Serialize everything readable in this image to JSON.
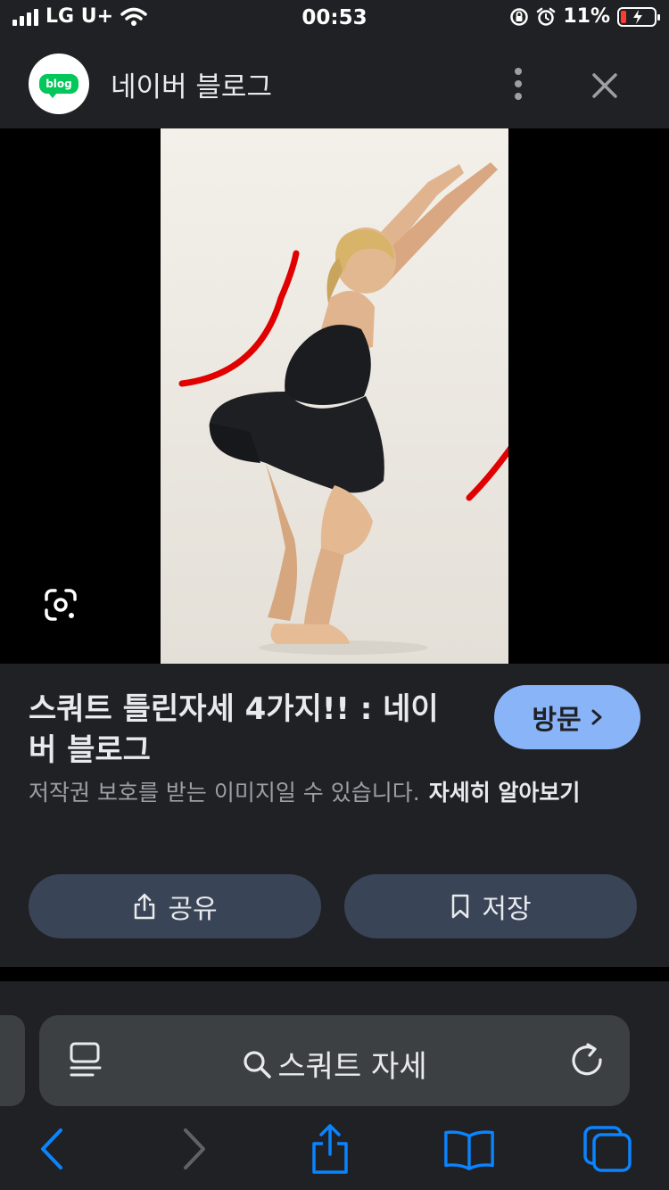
{
  "status_bar": {
    "carrier": "LG U+",
    "time": "00:53",
    "battery_percent": "11%",
    "battery_level": 0.11
  },
  "header": {
    "logo_text": "blog",
    "title": "네이버 블로그"
  },
  "result": {
    "title": "스쿼트 틀린자세 4가지!! : 네이버 블로그",
    "visit_label": "방문",
    "copyright_notice": "저작권 보호를 받는 이미지일 수 있습니다.",
    "learn_more": "자세히 알아보기",
    "share_label": "공유",
    "save_label": "저장"
  },
  "browser": {
    "search_query": "스쿼트 자세"
  },
  "colors": {
    "panel_bg": "#202124",
    "accent_button": "#8ab4f8",
    "action_button": "#394457",
    "toolbar_icon": "#0a84ff",
    "naver_green": "#03c75a"
  },
  "icons": {
    "visual_search": "google-lens-icon",
    "share": "share-icon",
    "save": "bookmark-icon",
    "reader": "reader-mode-icon",
    "search": "search-icon",
    "reload": "reload-icon"
  }
}
